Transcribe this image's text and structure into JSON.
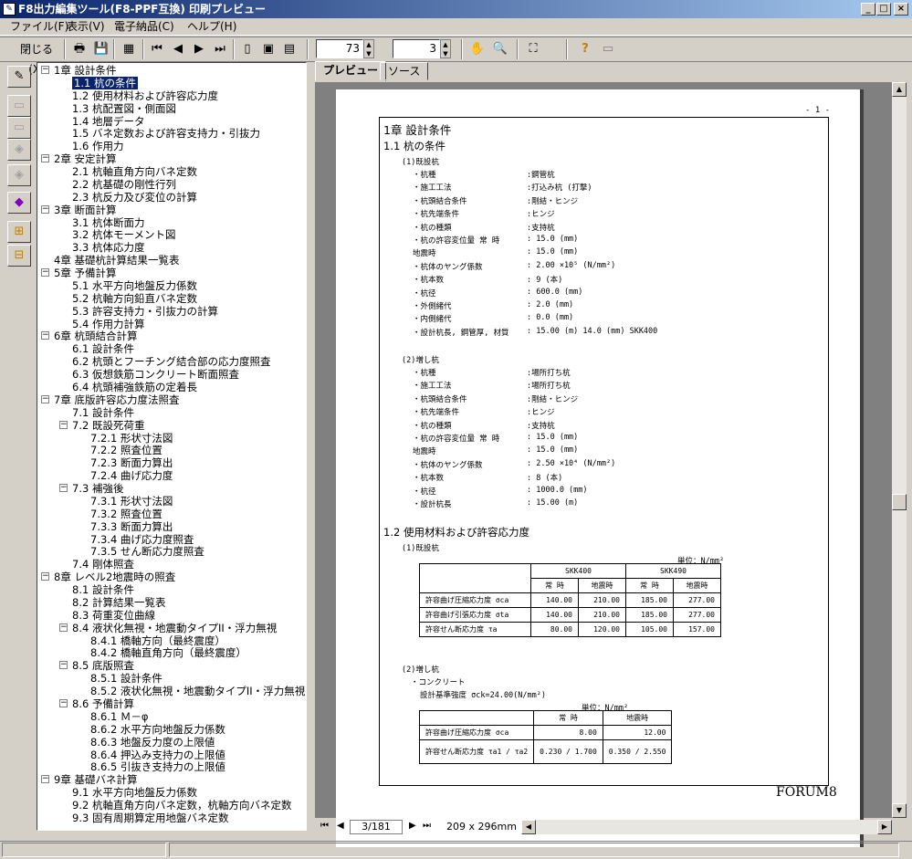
{
  "window": {
    "title": "F8出力編集ツール(F8-PPF互換) 印刷プレビュー",
    "min": "_",
    "max": "□",
    "close": "×"
  },
  "menu": [
    "ファイル(F)",
    "表示(V)",
    "電子納品(C)",
    "ヘルプ(H)"
  ],
  "toolbar": {
    "close_label": "閉じる(X)",
    "zoom": "73",
    "page_spin": "3"
  },
  "tabs": [
    "プレビュー",
    "ソース"
  ],
  "tree": [
    {
      "label": "1章 設計条件",
      "level": 0,
      "exp": "−"
    },
    {
      "label": "1.1 杭の条件",
      "level": 1,
      "sel": true
    },
    {
      "label": "1.2 使用材料および許容応力度",
      "level": 1
    },
    {
      "label": "1.3 杭配置図・側面図",
      "level": 1
    },
    {
      "label": "1.4 地層データ",
      "level": 1
    },
    {
      "label": "1.5 バネ定数および許容支持力・引抜力",
      "level": 1
    },
    {
      "label": "1.6 作用力",
      "level": 1
    },
    {
      "label": "2章 安定計算",
      "level": 0,
      "exp": "−"
    },
    {
      "label": "2.1 杭軸直角方向バネ定数",
      "level": 1
    },
    {
      "label": "2.2 杭基礎の剛性行列",
      "level": 1
    },
    {
      "label": "2.3 杭反力及び変位の計算",
      "level": 1
    },
    {
      "label": "3章 断面計算",
      "level": 0,
      "exp": "−"
    },
    {
      "label": "3.1 杭体断面力",
      "level": 1
    },
    {
      "label": "3.2 杭体モーメント図",
      "level": 1
    },
    {
      "label": "3.3 杭体応力度",
      "level": 1
    },
    {
      "label": "4章 基礎杭計算結果一覧表",
      "level": 0
    },
    {
      "label": "5章 予備計算",
      "level": 0,
      "exp": "−"
    },
    {
      "label": "5.1 水平方向地盤反力係数",
      "level": 1
    },
    {
      "label": "5.2 杭軸方向鉛直バネ定数",
      "level": 1
    },
    {
      "label": "5.3 許容支持力・引抜力の計算",
      "level": 1
    },
    {
      "label": "5.4 作用力計算",
      "level": 1
    },
    {
      "label": "6章 杭頭結合計算",
      "level": 0,
      "exp": "−"
    },
    {
      "label": "6.1 設計条件",
      "level": 1
    },
    {
      "label": "6.2 杭頭とフーチング結合部の応力度照査",
      "level": 1
    },
    {
      "label": "6.3 仮想鉄筋コンクリート断面照査",
      "level": 1
    },
    {
      "label": "6.4 杭頭補強鉄筋の定着長",
      "level": 1
    },
    {
      "label": "7章 底版許容応力度法照査",
      "level": 0,
      "exp": "−"
    },
    {
      "label": "7.1 設計条件",
      "level": 1
    },
    {
      "label": "7.2 既設死荷重",
      "level": 1,
      "exp": "−"
    },
    {
      "label": "7.2.1 形状寸法図",
      "level": 2
    },
    {
      "label": "7.2.2 照査位置",
      "level": 2
    },
    {
      "label": "7.2.3 断面力算出",
      "level": 2
    },
    {
      "label": "7.2.4 曲げ応力度",
      "level": 2
    },
    {
      "label": "7.3 補強後",
      "level": 1,
      "exp": "−"
    },
    {
      "label": "7.3.1 形状寸法図",
      "level": 2
    },
    {
      "label": "7.3.2 照査位置",
      "level": 2
    },
    {
      "label": "7.3.3 断面力算出",
      "level": 2
    },
    {
      "label": "7.3.4 曲げ応力度照査",
      "level": 2
    },
    {
      "label": "7.3.5 せん断応力度照査",
      "level": 2
    },
    {
      "label": "7.4 剛体照査",
      "level": 1
    },
    {
      "label": "8章 レベル2地震時の照査",
      "level": 0,
      "exp": "−"
    },
    {
      "label": "8.1 設計条件",
      "level": 1
    },
    {
      "label": "8.2 計算結果一覧表",
      "level": 1
    },
    {
      "label": "8.3 荷重変位曲線",
      "level": 1
    },
    {
      "label": "8.4 液状化無視・地震動タイプII・浮力無視",
      "level": 1,
      "exp": "−"
    },
    {
      "label": "8.4.1 橋軸方向（最終震度）",
      "level": 2
    },
    {
      "label": "8.4.2 橋軸直角方向（最終震度）",
      "level": 2
    },
    {
      "label": "8.5 底版照査",
      "level": 1,
      "exp": "−"
    },
    {
      "label": "8.5.1 設計条件",
      "level": 2
    },
    {
      "label": "8.5.2 液状化無視・地震動タイプII・浮力無視",
      "level": 2
    },
    {
      "label": "8.6 予備計算",
      "level": 1,
      "exp": "−"
    },
    {
      "label": "8.6.1 Ｍ－φ",
      "level": 2
    },
    {
      "label": "8.6.2 水平方向地盤反力係数",
      "level": 2
    },
    {
      "label": "8.6.3 地盤反力度の上限値",
      "level": 2
    },
    {
      "label": "8.6.4 押込み支持力の上限値",
      "level": 2
    },
    {
      "label": "8.6.5 引抜き支持力の上限値",
      "level": 2
    },
    {
      "label": "9章 基礎バネ計算",
      "level": 0,
      "exp": "−"
    },
    {
      "label": "9.1 水平方向地盤反力係数",
      "level": 1
    },
    {
      "label": "9.2 杭軸直角方向バネ定数，杭軸方向バネ定数",
      "level": 1
    },
    {
      "label": "9.3 固有周期算定用地盤バネ定数",
      "level": 1
    }
  ],
  "doc": {
    "pagenum": "- 1 -",
    "h1": "1章 設計条件",
    "h11": "1.1 杭の条件",
    "h12": "1.2 使用材料および許容応力度",
    "s1": "(1)既設杭",
    "s2": "(2)増し杭",
    "existing": [
      [
        "・杭種",
        ":鋼管杭"
      ],
      [
        "・施工工法",
        ":打込み杭 (打撃)"
      ],
      [
        "・杭頭結合条件",
        ":剛結・ヒンジ"
      ],
      [
        "・杭先端条件",
        ":ヒンジ"
      ],
      [
        "・杭の種類",
        ":支持杭"
      ],
      [
        "・杭の許容変位量  常  時",
        ":   15.0 (mm)"
      ],
      [
        "                地震時",
        ":   15.0 (mm)"
      ],
      [
        "・杭体のヤング係数",
        ":    2.00 ×10⁵ (N/mm²)"
      ],
      [
        "・杭本数",
        ":    9 (本)"
      ],
      [
        "・杭径",
        ":  600.0 (mm)"
      ],
      [
        "・外側緒代",
        ":    2.0 (mm)"
      ],
      [
        "・内側緒代",
        ":    0.0 (mm)"
      ],
      [
        "・設計杭長, 鋼管厚, 材質",
        ":   15.00 (m)      14.0 (mm)     SKK400"
      ]
    ],
    "added": [
      [
        "・杭種",
        ":場所打ち杭"
      ],
      [
        "・施工工法",
        ":場所打ち杭"
      ],
      [
        "・杭頭結合条件",
        ":剛結・ヒンジ"
      ],
      [
        "・杭先端条件",
        ":ヒンジ"
      ],
      [
        "・杭の種類",
        ":支持杭"
      ],
      [
        "・杭の許容変位量  常  時",
        ":   15.0 (mm)"
      ],
      [
        "                地震時",
        ":   15.0 (mm)"
      ],
      [
        "・杭体のヤング係数",
        ":    2.50 ×10⁴ (N/mm²)"
      ],
      [
        "・杭本数",
        ":    8 (本)"
      ],
      [
        "・杭径",
        ": 1000.0 (mm)"
      ],
      [
        "・設計杭長",
        ":   15.00 (m)"
      ]
    ],
    "mat_s1": "(1)既設杭",
    "unit": "単位：N/mm²",
    "t1_head": [
      "",
      "SKK400",
      "SKK490"
    ],
    "t1_sub": [
      "常 時",
      "地震時",
      "常 時",
      "地震時"
    ],
    "t1_rows": [
      [
        "許容曲げ圧縮応力度  σca",
        "140.00",
        "210.00",
        "185.00",
        "277.00"
      ],
      [
        "許容曲げ引張応力度  σta",
        "140.00",
        "210.00",
        "185.00",
        "277.00"
      ],
      [
        "許容せん断応力度    τa",
        "80.00",
        "120.00",
        "105.00",
        "157.00"
      ]
    ],
    "mat_s2": "(2)増し杭",
    "concrete": "・コンクリート",
    "ck": "設計基準強度  σck=24.00(N/mm²)",
    "t2_sub": [
      "常 時",
      "地震時"
    ],
    "t2_rows": [
      [
        "許容曲げ圧縮応力度  σca",
        "8.00",
        "12.00"
      ],
      [
        "許容せん断応力度  τa1 / τa2",
        "0.230 / 1.700",
        "0.350 / 2.550"
      ]
    ],
    "footer": "FORUM8"
  },
  "nav": {
    "page": "3/181",
    "size": "209 x 296mm"
  }
}
